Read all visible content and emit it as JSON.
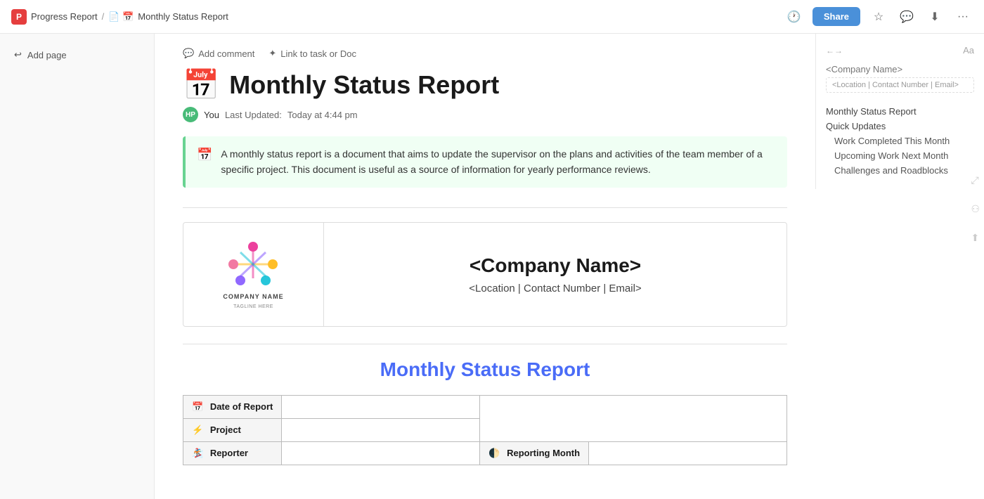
{
  "topbar": {
    "app_name": "Progress Report",
    "breadcrumb_sep": "/",
    "doc_icon": "📅",
    "doc_name": "Monthly Status Report",
    "share_label": "Share"
  },
  "sidebar_left": {
    "add_page_label": "Add page"
  },
  "action_bar": {
    "add_comment_label": "Add comment",
    "link_label": "Link to task or Doc"
  },
  "document": {
    "title_icon": "📅",
    "title": "Monthly Status Report",
    "author": "You",
    "last_updated_label": "Last Updated:",
    "last_updated_value": "Today at 4:44 pm",
    "callout_text": "A monthly status report is a document that aims to update the supervisor on the plans and activities of the team member of a specific project. This document is useful as a source of information for yearly performance reviews.",
    "company_name_placeholder": "<Company Name>",
    "company_contact_placeholder": "<Location | Contact Number | Email>",
    "section_title": "Monthly Status Report",
    "logo_company": "COMPANY NAME",
    "logo_tagline": "TAGLINE HERE",
    "table": {
      "rows": [
        {
          "icon": "📅",
          "label": "Date of Report",
          "value": "",
          "split": false
        },
        {
          "icon": "⚡",
          "label": "Project",
          "value": "",
          "split": false
        },
        {
          "icon": "🏂",
          "label": "Reporter",
          "value": "",
          "split": true,
          "right_icon": "🌓",
          "right_label": "Reporting Month",
          "right_value": ""
        }
      ]
    }
  },
  "right_sidebar": {
    "company_name": "<Company Name>",
    "contact": "<Location | Contact Number | Email>",
    "nav_items": [
      {
        "label": "Monthly Status Report",
        "level": 0
      },
      {
        "label": "Quick Updates",
        "level": 0
      },
      {
        "label": "Work Completed This Month",
        "level": 1
      },
      {
        "label": "Upcoming Work Next Month",
        "level": 1
      },
      {
        "label": "Challenges and Roadblocks",
        "level": 1
      }
    ]
  }
}
